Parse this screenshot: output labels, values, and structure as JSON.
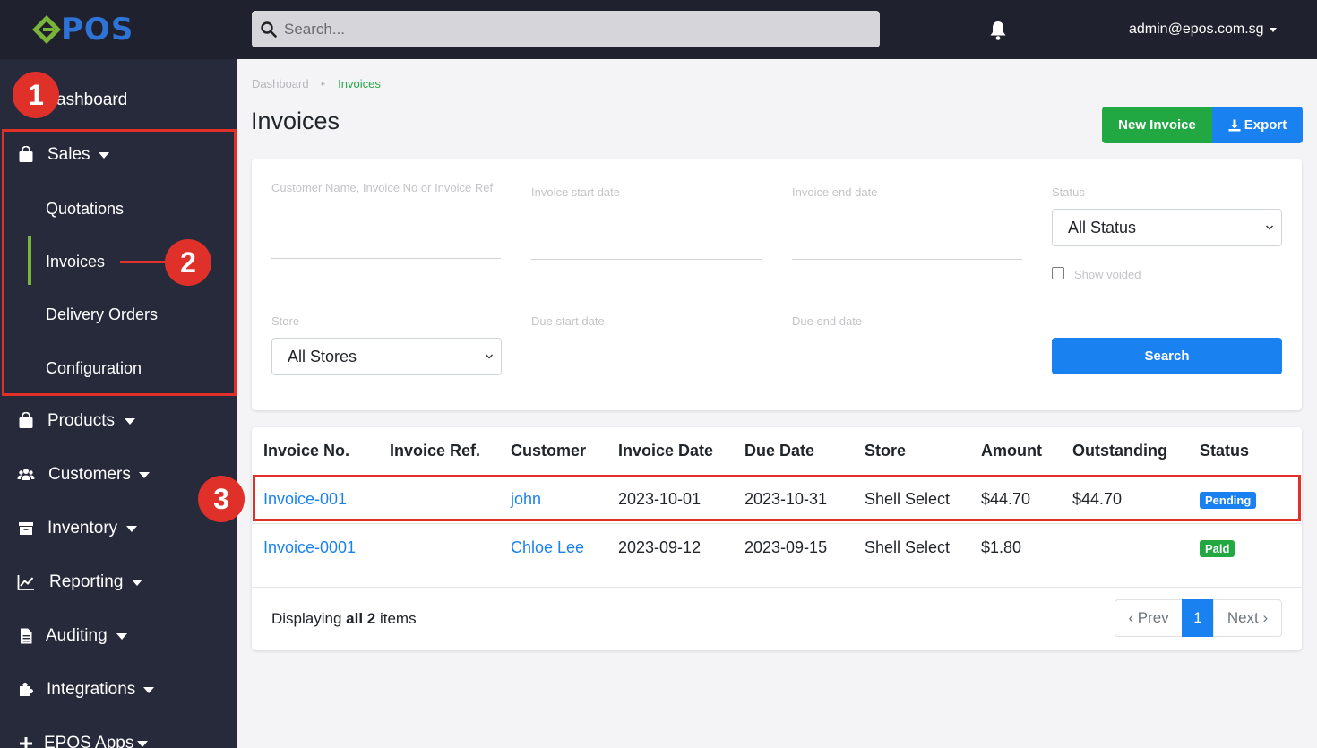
{
  "topbar": {
    "logo_text": "POS",
    "search_placeholder": "Search...",
    "user_email": "admin@epos.com.sg"
  },
  "sidebar": {
    "items": [
      {
        "label": "ashboard",
        "icon": "dashboard-icon"
      },
      {
        "label": "Sales",
        "icon": "shopping-bag-icon"
      },
      {
        "label": "Products",
        "icon": "shopping-bag-icon"
      },
      {
        "label": "Customers",
        "icon": "users-icon"
      },
      {
        "label": "Inventory",
        "icon": "archive-icon"
      },
      {
        "label": "Reporting",
        "icon": "chart-line-icon"
      },
      {
        "label": "Auditing",
        "icon": "file-icon"
      },
      {
        "label": "Integrations",
        "icon": "puzzle-icon"
      },
      {
        "label": "EPOS Apps",
        "icon": "plus-icon"
      }
    ],
    "sales_sub": [
      "Quotations",
      "Invoices",
      "Delivery Orders",
      "Configuration"
    ],
    "active_sub": "Invoices"
  },
  "annotations": [
    "1",
    "2",
    "3"
  ],
  "breadcrumb": {
    "home": "Dashboard",
    "current": "Invoices"
  },
  "page": {
    "title": "Invoices",
    "new_label": "New Invoice",
    "export_label": "Export"
  },
  "filters": {
    "customer_label": "Customer Name, Invoice No or Invoice Ref",
    "inv_start_label": "Invoice start date",
    "inv_end_label": "Invoice end date",
    "status_label": "Status",
    "status_value": "All Status",
    "show_voided_label": "Show voided",
    "store_label": "Store",
    "store_value": "All Stores",
    "due_start_label": "Due start date",
    "due_end_label": "Due end date",
    "search_label": "Search"
  },
  "table": {
    "headers": [
      "Invoice No.",
      "Invoice Ref.",
      "Customer",
      "Invoice Date",
      "Due Date",
      "Store",
      "Amount",
      "Outstanding",
      "Status"
    ],
    "rows": [
      {
        "invoice_no": "Invoice-001",
        "invoice_ref": "",
        "customer": "john",
        "invoice_date": "2023-10-01",
        "due_date": "2023-10-31",
        "store": "Shell Select",
        "amount": "$44.70",
        "outstanding": "$44.70",
        "status": "Pending"
      },
      {
        "invoice_no": "Invoice-0001",
        "invoice_ref": "",
        "customer": "Chloe Lee",
        "invoice_date": "2023-09-12",
        "due_date": "2023-09-15",
        "store": "Shell Select",
        "amount": "$1.80",
        "outstanding": "",
        "status": "Paid"
      }
    ],
    "footer": {
      "prefix": "Displaying ",
      "bold": "all 2",
      "suffix": " items"
    },
    "pagination": {
      "prev": "‹ Prev",
      "current": "1",
      "next": "Next ›"
    }
  },
  "colors": {
    "sidebar_bg": "#262a3b",
    "topbar_bg": "#20212e",
    "primary": "#1a82f0",
    "success": "#22a843",
    "annotation_red": "#e0302a",
    "active_indicator": "#7ab53a"
  }
}
